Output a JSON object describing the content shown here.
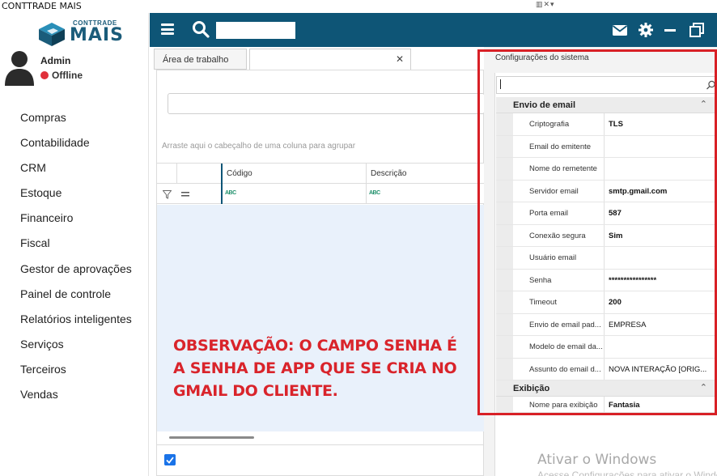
{
  "app": {
    "title": "CONTTRADE MAIS",
    "window_controls": "▥✕▾"
  },
  "logo": {
    "top": "CONTTRADE",
    "main": "MAIS"
  },
  "user": {
    "name": "Admin",
    "status": "Offline",
    "status_color": "#e0303a"
  },
  "menu": [
    "Compras",
    "Contabilidade",
    "CRM",
    "Estoque",
    "Financeiro",
    "Fiscal",
    "Gestor de aprovações",
    "Painel de controle",
    "Relatórios inteligentes",
    "Serviços",
    "Terceiros",
    "Vendas"
  ],
  "header": {
    "search_value": "",
    "color": "#0e5576"
  },
  "tabs": [
    {
      "label": "Área de trabalho"
    },
    {
      "label": ""
    }
  ],
  "tab_close": "✕",
  "grid": {
    "group_hint": "Arraste aqui o cabeçalho de uma coluna para agrupar",
    "columns": [
      "Código",
      "Descrição"
    ],
    "filter_glyph": "ABC"
  },
  "note": "OBSERVAÇÃO: O CAMPO SENHA É A SENHA DE APP QUE SE CRIA NO GMAIL DO CLIENTE.",
  "config": {
    "title": "Configurações do sistema",
    "search_value": "",
    "categories": [
      {
        "name": "Envio de email",
        "chevron": "⌃",
        "props": [
          {
            "name": "Criptografia",
            "value": "TLS",
            "bold": true
          },
          {
            "name": "Email do emitente",
            "value": "",
            "bold": false
          },
          {
            "name": "Nome do remetente",
            "value": "",
            "bold": false
          },
          {
            "name": "Servidor email",
            "value": "smtp.gmail.com",
            "bold": true
          },
          {
            "name": "Porta email",
            "value": "587",
            "bold": true
          },
          {
            "name": "Conexão segura",
            "value": "Sim",
            "bold": true
          },
          {
            "name": "Usuário email",
            "value": "",
            "bold": false
          },
          {
            "name": "Senha",
            "value": "****************",
            "bold": true
          },
          {
            "name": "Timeout",
            "value": "200",
            "bold": true
          },
          {
            "name": "Envio de email pad...",
            "value": "EMPRESA",
            "bold": false
          },
          {
            "name": "Modelo de email da...",
            "value": "",
            "bold": false
          },
          {
            "name": "Assunto do email d...",
            "value": "NOVA INTERAÇÃO [ORIG...",
            "bold": false
          }
        ]
      },
      {
        "name": "Exibição",
        "chevron": "⌃",
        "props": [
          {
            "name": "Nome para exibição",
            "value": "Fantasia",
            "bold": true
          }
        ]
      }
    ]
  },
  "watermark": {
    "title": "Ativar o Windows",
    "subtitle": "Acesse Configurações para ativar o Windows."
  },
  "colors": {
    "accent": "#0e5576",
    "highlight": "#d82026",
    "note": "#d9242b",
    "checkbox": "#1a73e8"
  }
}
